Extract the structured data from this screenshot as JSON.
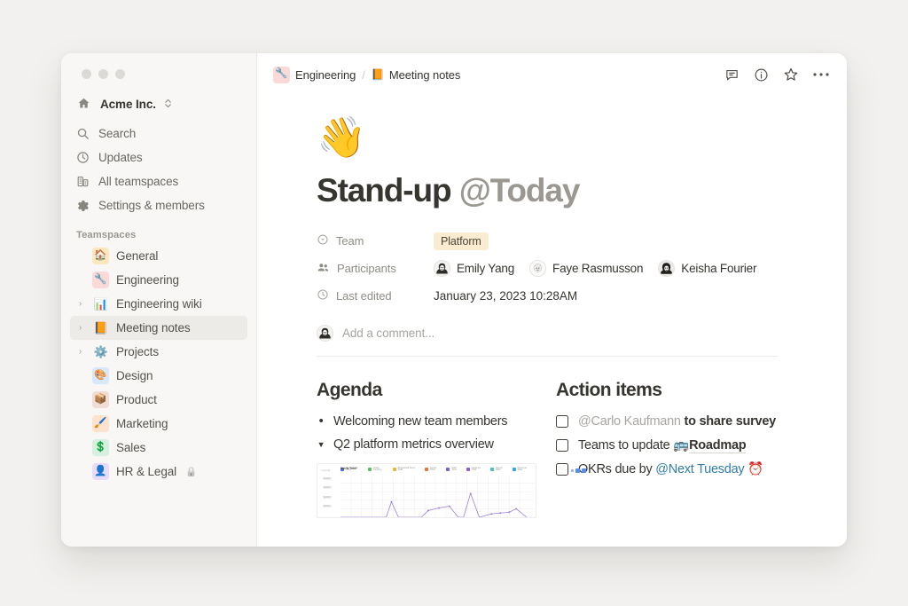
{
  "window": {
    "traffic_lights": [
      "close",
      "minimize",
      "maximize"
    ]
  },
  "sidebar": {
    "workspace": {
      "name": "Acme Inc.",
      "icon": "house-icon",
      "switch_icon": "chevron-updown-icon"
    },
    "nav": [
      {
        "label": "Search",
        "icon": "search-icon"
      },
      {
        "label": "Updates",
        "icon": "clock-icon"
      },
      {
        "label": "All teamspaces",
        "icon": "building-icon"
      },
      {
        "label": "Settings & members",
        "icon": "gear-icon"
      }
    ],
    "section_label": "Teamspaces",
    "teamspaces": [
      {
        "label": "General",
        "emoji": "🏠",
        "badge_bg": "#fbe7bd",
        "expandable": false,
        "selected": false,
        "locked": false
      },
      {
        "label": "Engineering",
        "emoji": "🔧",
        "badge_bg": "#fbd9d9",
        "expandable": false,
        "selected": false,
        "locked": false
      },
      {
        "label": "Engineering wiki",
        "emoji": "📊",
        "badge_bg": "transparent",
        "expandable": true,
        "selected": false,
        "locked": false
      },
      {
        "label": "Meeting notes",
        "emoji": "📙",
        "badge_bg": "transparent",
        "expandable": true,
        "selected": true,
        "locked": false
      },
      {
        "label": "Projects",
        "emoji": "⚙️",
        "badge_bg": "transparent",
        "expandable": true,
        "selected": false,
        "locked": false
      },
      {
        "label": "Design",
        "emoji": "🎨",
        "badge_bg": "#d8e8fb",
        "expandable": false,
        "selected": false,
        "locked": false
      },
      {
        "label": "Product",
        "emoji": "📦",
        "badge_bg": "#f0ddd5",
        "expandable": false,
        "selected": false,
        "locked": false
      },
      {
        "label": "Marketing",
        "emoji": "🖌️",
        "badge_bg": "#fde2ce",
        "expandable": false,
        "selected": false,
        "locked": false
      },
      {
        "label": "Sales",
        "emoji": "💲",
        "badge_bg": "#d6f0de",
        "expandable": false,
        "selected": false,
        "locked": false
      },
      {
        "label": "HR & Legal",
        "emoji": "👤",
        "badge_bg": "#e6dcf7",
        "expandable": false,
        "selected": false,
        "locked": true,
        "lock_icon": "🔒"
      }
    ]
  },
  "topbar": {
    "breadcrumb": [
      {
        "label": "Engineering",
        "emoji": "🔧",
        "badge_bg": "#fbd9d9"
      },
      {
        "label": "Meeting notes",
        "emoji": "📙",
        "badge_bg": "transparent"
      }
    ],
    "separator": "/",
    "actions": [
      {
        "name": "comment-icon"
      },
      {
        "name": "info-icon"
      },
      {
        "name": "star-icon"
      },
      {
        "name": "more-options-icon"
      }
    ]
  },
  "doc": {
    "emoji": "👋",
    "title_main": "Stand-up ",
    "title_mention": "@Today",
    "properties": [
      {
        "key": "Team",
        "icon": "select-icon",
        "type": "tag",
        "value": "Platform"
      },
      {
        "key": "Participants",
        "icon": "people-icon",
        "type": "people",
        "value": [
          "Emily Yang",
          "Faye Rasmusson",
          "Keisha Fourier"
        ]
      },
      {
        "key": "Last edited",
        "icon": "clock-icon",
        "type": "text",
        "value": "January 23, 2023 10:28AM"
      }
    ],
    "comment": {
      "placeholder": "Add a comment...",
      "avatar": "avatar-emily"
    },
    "agenda": {
      "heading": "Agenda",
      "items": [
        {
          "marker": "bullet",
          "text": "Welcoming new team members"
        },
        {
          "marker": "toggle",
          "text": "Q2 platform metrics overview"
        }
      ]
    },
    "action_items": {
      "heading": "Action items",
      "items": [
        {
          "checked": false,
          "mention": "@Carlo Kaufmann",
          "text": " to share survey",
          "trailing": ""
        },
        {
          "checked": false,
          "pre": "Teams to update ",
          "pagelink": "Roadmap",
          "link_emoji": "🚌"
        },
        {
          "checked": false,
          "pre": "OKRs due by ",
          "date_mention": "@Next Tuesday",
          "trailing_emoji": "⏰"
        }
      ]
    }
  },
  "chart_data": {
    "type": "line",
    "title": "Metric Total",
    "corner_label": "< Format",
    "legend": [
      {
        "label": "Support Tier Ultra",
        "color": "#4a6fe3"
      },
      {
        "label": "Order Pending",
        "color": "#5bbf6a"
      },
      {
        "label": "Requested Items Sold",
        "color": "#f2b233"
      },
      {
        "label": "Issues Total",
        "color": "#e8743b"
      },
      {
        "label": "Staff Time",
        "color": "#7b5fd4"
      },
      {
        "label": "Cadence Total",
        "color": "#8b5fd4"
      },
      {
        "label": "Spend Rate",
        "color": "#4bc0c0"
      },
      {
        "label": "Revenue Rate",
        "color": "#3aa6d8"
      }
    ],
    "ytick_labels": [
      "$400K",
      "$300K",
      "$200K",
      "$100K"
    ],
    "ylim": [
      0,
      400000
    ],
    "grid": true,
    "legend_position": "top",
    "series": [
      {
        "name": "Metric Total",
        "color": "#9b7fd4",
        "x": [
          0,
          1,
          2,
          3,
          4,
          5,
          6,
          7,
          8,
          9,
          10,
          11,
          12,
          13,
          14,
          15,
          16,
          17,
          18,
          19
        ],
        "values": [
          0,
          0,
          0,
          0,
          0,
          20,
          170,
          0,
          0,
          95,
          115,
          130,
          0,
          245,
          0,
          35,
          40,
          55,
          75,
          0
        ]
      }
    ]
  }
}
